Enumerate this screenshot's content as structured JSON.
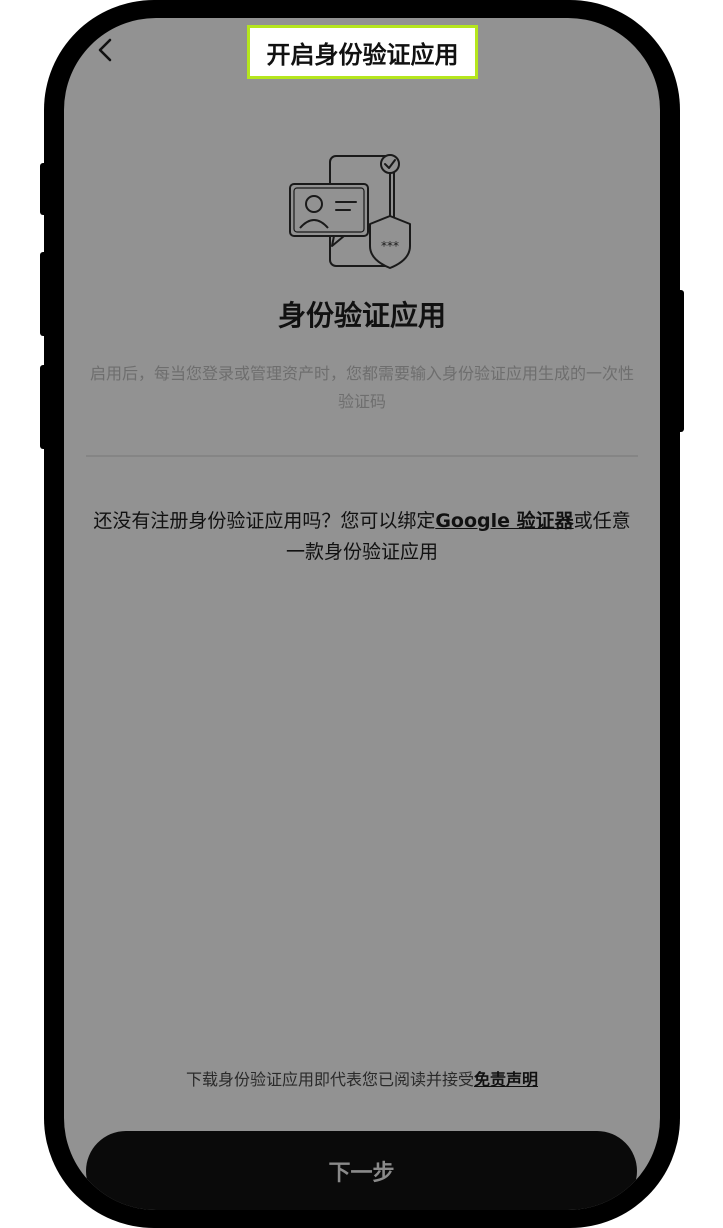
{
  "header": {
    "title": "开启身份验证应用",
    "back_icon": "chevron-left-icon"
  },
  "hero": {
    "icon": "authenticator-illustration-icon"
  },
  "main": {
    "heading": "身份验证应用",
    "description": "启用后，每当您登录或管理资产时，您都需要输入身份验证应用生成的一次性验证码",
    "hint_prefix": "还没有注册身份验证应用吗？您可以绑定",
    "hint_link": "Google 验证器",
    "hint_suffix": "或任意一款身份验证应用"
  },
  "footer": {
    "note_prefix": "下载身份验证应用即代表您已阅读并接受",
    "note_link": "免责声明",
    "next_label": "下一步"
  },
  "colors": {
    "highlight_border": "#b5e61d",
    "screen_bg": "#929292"
  }
}
